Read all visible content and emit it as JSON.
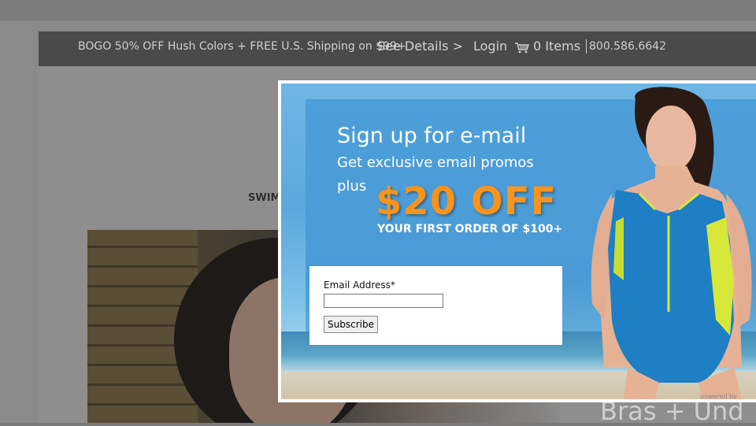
{
  "header": {
    "promo_text": "BOGO 50% OFF Hush Colors + FREE U.S. Shipping on $99+",
    "see_details": "See Details >",
    "login": "Login",
    "cart_items": "0 Items",
    "phone": "800.586.6642"
  },
  "main": {
    "category_label": "SWIM",
    "hero_heading": "Bras + Und"
  },
  "popup": {
    "title": "Sign up for e-mail",
    "subtitle": "Get exclusive email promos",
    "plus": "plus",
    "offer": "$20 OFF",
    "offer_condition": "YOUR FIRST ORDER OF $100+",
    "email_label": "Email Address*",
    "email_value": "",
    "subscribe_label": "Subscribe",
    "powered_by": "powered by"
  },
  "colors": {
    "offer_orange": "#f7941d",
    "popup_blue": "#4d9fd9",
    "swimsuit_blue": "#1e7fc4",
    "swimsuit_lime": "#d7e83a"
  }
}
